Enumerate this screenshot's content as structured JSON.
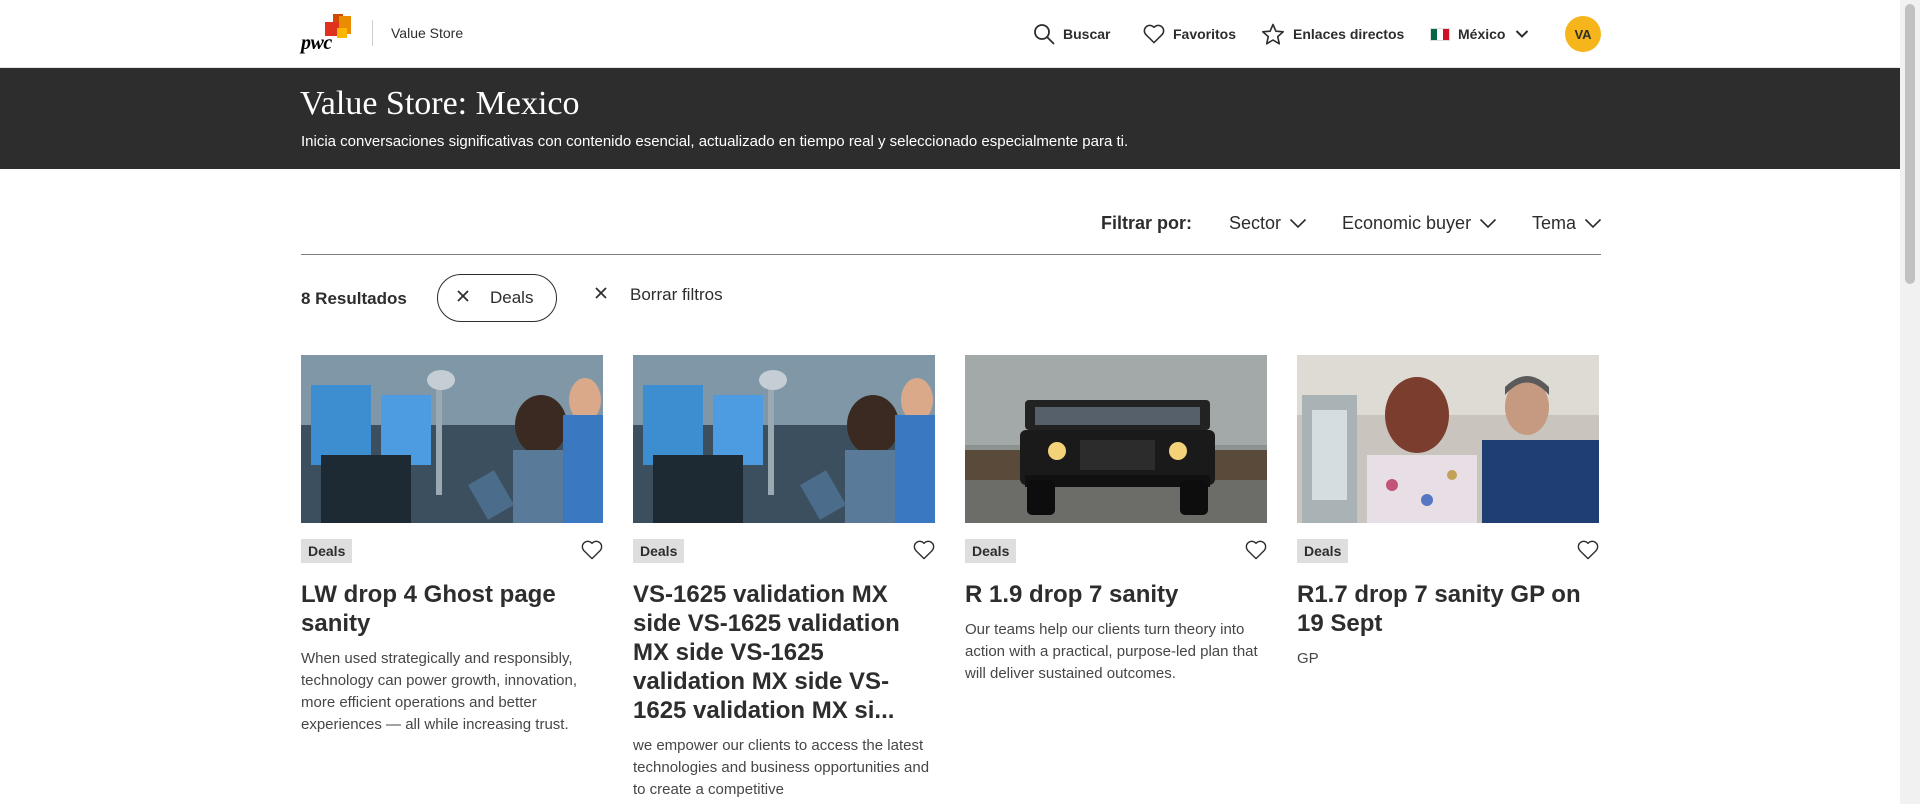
{
  "nav": {
    "brand": "Value Store",
    "logo_text": "pwc",
    "search": "Buscar",
    "favorites": "Favoritos",
    "links": "Enlaces directos",
    "country": "México",
    "avatar": "VA"
  },
  "hero": {
    "title": "Value Store: Mexico",
    "subtitle": "Inicia conversaciones significativas con contenido esencial, actualizado en tiempo real y seleccionado especialmente para ti."
  },
  "filters": {
    "label": "Filtrar por:",
    "sector": "Sector",
    "buyer": "Economic buyer",
    "tema": "Tema",
    "results": "8 Resultados",
    "active_chip": "Deals",
    "clear": "Borrar filtros"
  },
  "cards": [
    {
      "tag": "Deals",
      "title": "LW drop 4 Ghost page sanity",
      "desc": "When used strategically and responsibly, technology can power growth, innovation, more efficient operations and better experiences — all while increasing trust."
    },
    {
      "tag": "Deals",
      "title": "VS-1625 validation MX side VS-1625 validation MX side VS-1625 validation MX side VS-1625 validation MX si...",
      "desc": "we empower our clients to access the latest technologies and business opportunities and to create a competitive"
    },
    {
      "tag": "Deals",
      "title": "R 1.9 drop 7 sanity",
      "desc": "Our teams help our clients turn theory into action with a practical, purpose-led plan that will deliver sustained outcomes."
    },
    {
      "tag": "Deals",
      "title": "R1.7 drop 7 sanity GP on 19 Sept",
      "desc": "GP"
    }
  ],
  "colors": {
    "hero_bg": "#2d2d2d",
    "avatar_bg": "#f5b51b",
    "tag_bg": "#dedede"
  }
}
